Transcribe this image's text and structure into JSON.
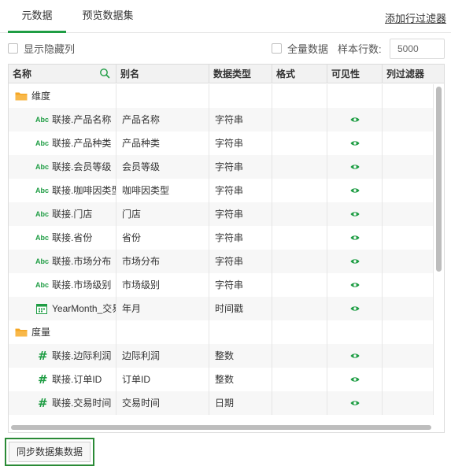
{
  "tabs": [
    {
      "label": "元数据"
    },
    {
      "label": "预览数据集"
    }
  ],
  "add_filter_label": "添加行过滤器",
  "options": {
    "show_hidden_label": "显示隐藏列",
    "full_data_label": "全量数据",
    "sample_rows_label": "样本行数:",
    "sample_rows_value": "5000"
  },
  "table": {
    "headers": [
      "名称",
      "别名",
      "数据类型",
      "格式",
      "可见性",
      "列过滤器"
    ],
    "groups": [
      {
        "label": "维度",
        "fields": [
          {
            "icon": "abc-icon",
            "name": "联接.产品名称",
            "alias": "产品名称",
            "type": "字符串",
            "visible": true
          },
          {
            "icon": "abc-icon",
            "name": "联接.产品种类",
            "alias": "产品种类",
            "type": "字符串",
            "visible": true
          },
          {
            "icon": "abc-icon",
            "name": "联接.会员等级",
            "alias": "会员等级",
            "type": "字符串",
            "visible": true
          },
          {
            "icon": "abc-icon",
            "name": "联接.咖啡因类型",
            "alias": "咖啡因类型",
            "type": "字符串",
            "visible": true
          },
          {
            "icon": "abc-icon",
            "name": "联接.门店",
            "alias": "门店",
            "type": "字符串",
            "visible": true
          },
          {
            "icon": "abc-icon",
            "name": "联接.省份",
            "alias": "省份",
            "type": "字符串",
            "visible": true
          },
          {
            "icon": "abc-icon",
            "name": "联接.市场分布",
            "alias": "市场分布",
            "type": "字符串",
            "visible": true
          },
          {
            "icon": "abc-icon",
            "name": "联接.市场级别",
            "alias": "市场级别",
            "type": "字符串",
            "visible": true
          },
          {
            "icon": "calendar-icon",
            "name": "YearMonth_交易",
            "alias": "年月",
            "type": "时间戳",
            "visible": true
          }
        ]
      },
      {
        "label": "度量",
        "fields": [
          {
            "icon": "hash-icon",
            "name": "联接.边际利润",
            "alias": "边际利润",
            "type": "整数",
            "visible": true
          },
          {
            "icon": "hash-icon",
            "name": "联接.订单ID",
            "alias": "订单ID",
            "type": "整数",
            "visible": true
          },
          {
            "icon": "hash-icon",
            "name": "联接.交易时间",
            "alias": "交易时间",
            "type": "日期",
            "visible": true
          }
        ]
      }
    ]
  },
  "sync_button_label": "同步数据集数据",
  "colors": {
    "accent": "#1f9d44",
    "folder": "#f5a623",
    "button_border": "#2a8a36"
  }
}
